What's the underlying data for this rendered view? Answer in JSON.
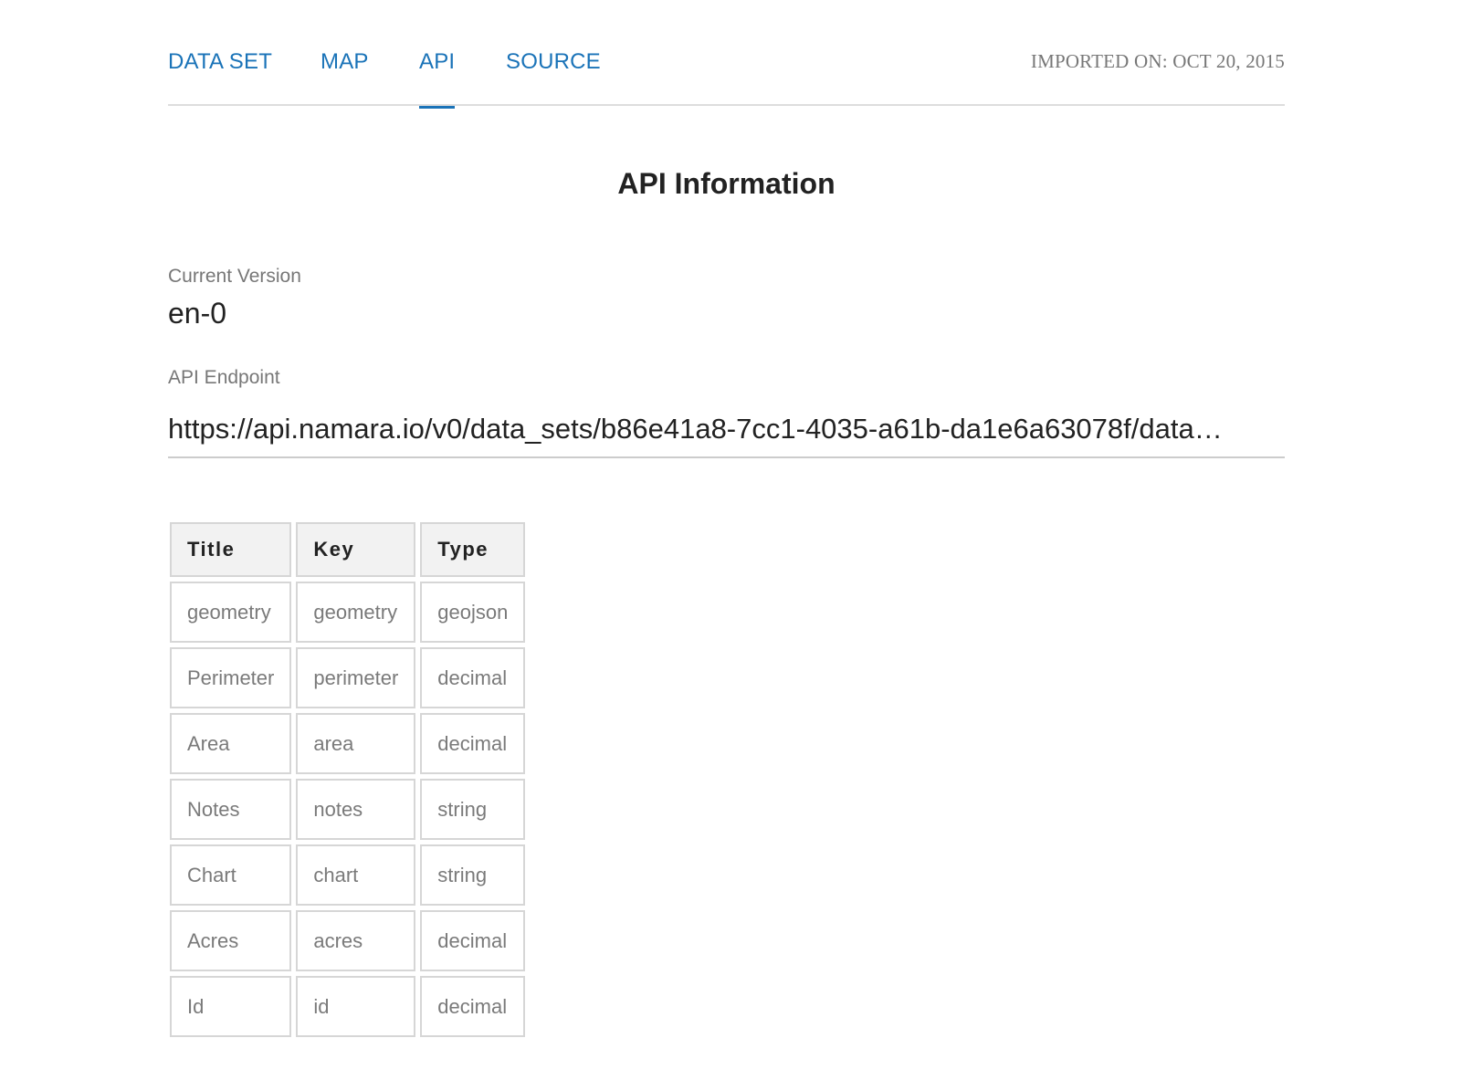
{
  "nav": {
    "tabs": [
      {
        "label": "DATA SET",
        "active": false
      },
      {
        "label": "MAP",
        "active": false
      },
      {
        "label": "API",
        "active": true
      },
      {
        "label": "SOURCE",
        "active": false
      }
    ],
    "imported_on": "IMPORTED ON: OCT 20, 2015"
  },
  "colors": {
    "accent": "#1a73b8",
    "muted_text": "#777777",
    "header_bg": "#f2f2f2",
    "border": "#d6d6d6"
  },
  "page": {
    "title": "API Information"
  },
  "version": {
    "label": "Current Version",
    "value": "en-0"
  },
  "endpoint": {
    "label": "API Endpoint",
    "value": "https://api.namara.io/v0/data_sets/b86e41a8-7cc1-4035-a61b-da1e6a63078f/data…"
  },
  "table": {
    "headers": [
      "Title",
      "Key",
      "Type"
    ],
    "rows": [
      [
        "geometry",
        "geometry",
        "geojson"
      ],
      [
        "Perimeter",
        "perimeter",
        "decimal"
      ],
      [
        "Area",
        "area",
        "decimal"
      ],
      [
        "Notes",
        "notes",
        "string"
      ],
      [
        "Chart",
        "chart",
        "string"
      ],
      [
        "Acres",
        "acres",
        "decimal"
      ],
      [
        "Id",
        "id",
        "decimal"
      ]
    ]
  }
}
